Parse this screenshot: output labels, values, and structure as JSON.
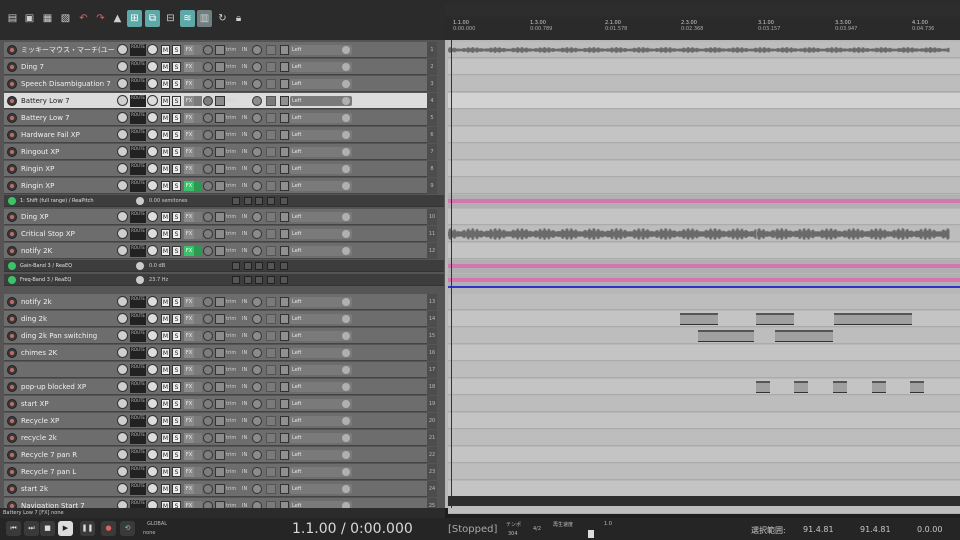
{
  "colors": {
    "accent": "#5fa8a8",
    "fx_on": "#3cc36a",
    "pink_lane": "#e060b0",
    "blue_line": "#3030d0"
  },
  "toolbar": {
    "icons": [
      "new-project",
      "open-project",
      "save-project",
      "project-settings",
      "undo",
      "redo",
      "metronome",
      "snap",
      "ripple",
      "grid",
      "auto-crossfade",
      "loop",
      "lock"
    ]
  },
  "tracks": [
    {
      "name": "ミッキーマウス・マーチ(ユーロビート",
      "num": "1"
    },
    {
      "name": "Ding 7",
      "num": "2"
    },
    {
      "name": "Speech Disambiguation 7",
      "num": "3"
    },
    {
      "name": "Battery Low 7",
      "num": "4"
    },
    {
      "name": "Battery Low 7",
      "num": "5"
    },
    {
      "name": "Hardware Fail XP",
      "num": "6"
    },
    {
      "name": "Ringout XP",
      "num": "7"
    },
    {
      "name": "Ringin XP",
      "num": "8"
    },
    {
      "name": "Ringin XP",
      "num": "9"
    },
    {
      "name": "Ding XP",
      "num": "10"
    },
    {
      "name": "Critical Stop XP",
      "num": "11"
    },
    {
      "name": "notify 2K",
      "num": "12"
    },
    {
      "name": "notify 2k",
      "num": "13"
    },
    {
      "name": "ding 2k",
      "num": "14"
    },
    {
      "name": "ding 2k Pan switching",
      "num": "15"
    },
    {
      "name": "chimes 2K",
      "num": "16"
    },
    {
      "name": "",
      "num": "17"
    },
    {
      "name": "pop-up blocked XP",
      "num": "18"
    },
    {
      "name": "start XP",
      "num": "19"
    },
    {
      "name": "Recycle XP",
      "num": "20"
    },
    {
      "name": "recycle 2k",
      "num": "21"
    },
    {
      "name": "Recycle 7 pan R",
      "num": "22"
    },
    {
      "name": "Recycle 7 pan L",
      "num": "23"
    },
    {
      "name": "start 2k",
      "num": "24"
    },
    {
      "name": "Navigation Start 7",
      "num": "25"
    }
  ],
  "track_buttons": {
    "mute": "M",
    "solo": "S",
    "fx": "FX",
    "input": "IN",
    "route": "ROUTE",
    "trim": "trim",
    "input_channel": "Left"
  },
  "fx_lanes": [
    {
      "label": "1: Shift (full range) / ReaPitch",
      "value": "0.00 semitones"
    },
    {
      "label": "Gain-Band 3 / ReaEQ",
      "value": "0.0 dB"
    },
    {
      "label": "Freq-Band 3 / ReaEQ",
      "value": "23.7 Hz"
    }
  ],
  "ruler": [
    {
      "bar": "1.1.00",
      "time": "0:00.000"
    },
    {
      "bar": "1.3.00",
      "time": "0:00.789"
    },
    {
      "bar": "2.1.00",
      "time": "0:01.578"
    },
    {
      "bar": "2.3.00",
      "time": "0:02.368"
    },
    {
      "bar": "3.1.00",
      "time": "0:03.157"
    },
    {
      "bar": "3.3.00",
      "time": "0:03.947"
    },
    {
      "bar": "4.1.00",
      "time": "0:04.736"
    }
  ],
  "status": {
    "text": "Battery Low 7 [FX] none"
  },
  "transport": {
    "timecode": "1.1.00 / 0:00.000",
    "state": "[Stopped]",
    "tempo_label": "テンポ",
    "tempo": "304",
    "timesig": "4/2",
    "rate_label": "再生速度",
    "rate": "1.0",
    "selection_label": "選択範囲:",
    "sel_start": "91.4.81",
    "sel_end": "91.4.81",
    "sel_len": "0.0.00",
    "global_label": "GLOBAL",
    "global_value": "none"
  }
}
